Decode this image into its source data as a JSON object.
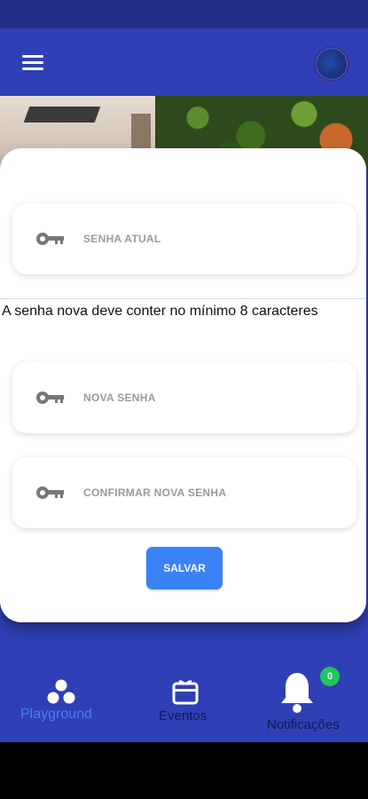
{
  "current_password": {
    "placeholder": "SENHA ATUAL"
  },
  "hint": "A senha nova deve conter no mínimo 8 caracteres",
  "new_password": {
    "placeholder": "NOVA SENHA"
  },
  "confirm_password": {
    "placeholder": "CONFIRMAR NOVA SENHA"
  },
  "save_label": "SALVAR",
  "bottom_nav": {
    "playground": "Playground",
    "eventos": "Eventos",
    "notificacoes": "Notificações",
    "notification_count": "0"
  },
  "colors": {
    "appbar": "#2f3fb6",
    "statusbar": "#232f86",
    "active_tab": "#3b82f6",
    "save_button": "#3b82f6",
    "badge": "#22c55e"
  },
  "icons": [
    "menu-icon",
    "avatar",
    "key-icon",
    "playground-icon",
    "gift-icon",
    "bell-icon"
  ]
}
